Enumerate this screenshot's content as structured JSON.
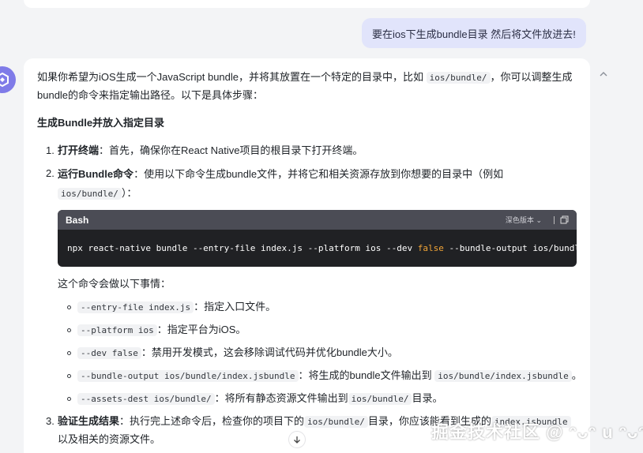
{
  "user_message": "要在ios下生成bundle目录 然后将文件放进去!",
  "answer": {
    "intro_before_code": "如果你希望为iOS生成一个JavaScript bundle，并将其放置在一个特定的目录中，比如",
    "intro_code": "ios/bundle/",
    "intro_after_code": "，你可以调整生成",
    "intro_line2": "bundle的命令来指定输出路径。以下是具体步骤：",
    "heading": "生成Bundle并放入指定目录",
    "step1": {
      "num": "1.",
      "label": "打开终端",
      "text": "：首先，确保你在React Native项目的根目录下打开终端。"
    },
    "step2": {
      "num": "2.",
      "label": "运行Bundle命令",
      "text": "：使用以下命令生成bundle文件，并将它和相关资源存放到你想要的目录中（例如",
      "code": "ios/bundle/",
      "close": "）："
    },
    "codeblock": {
      "lang": "Bash",
      "theme_label": "深色版本",
      "cmd_before": "npx react-native bundle --entry-file index.js --platform ios --dev ",
      "cmd_keyword": "false",
      "cmd_after": " --bundle-output ios/bundle/in"
    },
    "explain": "这个命令会做以下事情：",
    "bullets": [
      {
        "code": "--entry-file index.js",
        "text": "：指定入口文件。"
      },
      {
        "code": "--platform ios",
        "text": "：指定平台为iOS。"
      },
      {
        "code": "--dev false",
        "text": "：禁用开发模式，这会移除调试代码并优化bundle大小。"
      },
      {
        "code": "--bundle-output ios/bundle/index.jsbundle",
        "text": "：将生成的bundle文件输出到",
        "code2": "ios/bundle/index.jsbundle",
        "tail": "。"
      },
      {
        "code": "--assets-dest ios/bundle/",
        "text": "：将所有静态资源文件输出到",
        "code2": "ios/bundle/",
        "tail": "目录。"
      }
    ],
    "step3": {
      "num": "3.",
      "label": "验证生成结果",
      "text": "：执行完上述命令后，检查你的项目下的",
      "code": "ios/bundle/",
      "text2": "目录，你应该能看到生成的",
      "code2": "index.jsbundle",
      "line2": "以及相关的资源文件。"
    }
  },
  "watermark": "掘金技术社区 @ ᵔᴗᵔ u ᵔᴗᵔ"
}
